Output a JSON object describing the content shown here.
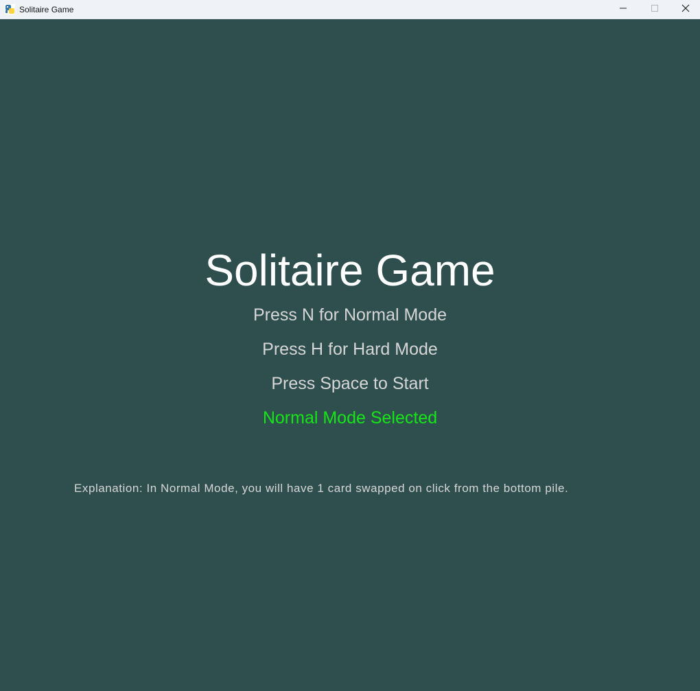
{
  "window": {
    "title": "Solitaire Game",
    "icon": "python-icon",
    "controls": {
      "minimize_icon": "minimize-icon",
      "maximize_icon": "maximize-icon",
      "close_icon": "close-icon"
    }
  },
  "game": {
    "title": "Solitaire Game",
    "instructions": [
      "Press N for Normal Mode",
      "Press H for Hard Mode",
      "Press Space to Start"
    ],
    "selected_mode": "Normal Mode Selected",
    "explanation": "Explanation: In Normal Mode, you will have 1 card swapped on click from the bottom pile."
  },
  "colors": {
    "background": "#2f4f4f",
    "title": "#ffffff",
    "instruction_text": "#d6d6d6",
    "selected_text": "#16e616",
    "titlebar": "#eff3f7"
  }
}
